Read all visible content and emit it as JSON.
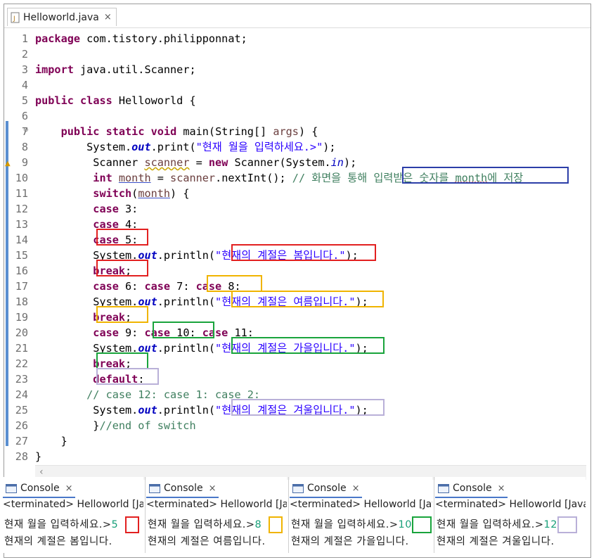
{
  "editor_tab": {
    "title": "Helloworld.java",
    "close": "×"
  },
  "code_lines": [
    {
      "n": "1",
      "segments": [
        {
          "t": "package",
          "c": "kw"
        },
        {
          "t": " com.tistory.philipponnat;",
          "c": ""
        }
      ]
    },
    {
      "n": "2",
      "segments": []
    },
    {
      "n": "3",
      "segments": [
        {
          "t": "import",
          "c": "kw"
        },
        {
          "t": " java.util.Scanner;",
          "c": ""
        }
      ]
    },
    {
      "n": "4",
      "segments": []
    },
    {
      "n": "5",
      "segments": [
        {
          "t": "public",
          "c": "kw"
        },
        {
          "t": " ",
          "c": ""
        },
        {
          "t": "class",
          "c": "kw"
        },
        {
          "t": " Helloworld {",
          "c": ""
        }
      ]
    },
    {
      "n": "6",
      "segments": []
    },
    {
      "n": "7",
      "segments": [
        {
          "t": "    ",
          "c": ""
        },
        {
          "t": "public",
          "c": "kw"
        },
        {
          "t": " ",
          "c": ""
        },
        {
          "t": "static",
          "c": "kw"
        },
        {
          "t": " ",
          "c": ""
        },
        {
          "t": "void",
          "c": "kw"
        },
        {
          "t": " main(String[] ",
          "c": ""
        },
        {
          "t": "args",
          "c": "var"
        },
        {
          "t": ") {",
          "c": ""
        }
      ]
    },
    {
      "n": "8",
      "segments": [
        {
          "t": "        System.",
          "c": ""
        },
        {
          "t": "out",
          "c": "fld"
        },
        {
          "t": ".print(",
          "c": ""
        },
        {
          "t": "\"현재 월을 입력하세요.>\"",
          "c": "str"
        },
        {
          "t": ");",
          "c": ""
        }
      ]
    },
    {
      "n": "9",
      "segments": [
        {
          "t": "         Scanner ",
          "c": ""
        },
        {
          "t": "scanner",
          "c": "uvar"
        },
        {
          "t": " = ",
          "c": ""
        },
        {
          "t": "new",
          "c": "kw"
        },
        {
          "t": " Scanner(System.",
          "c": ""
        },
        {
          "t": "in",
          "c": "fldi"
        },
        {
          "t": ");",
          "c": ""
        }
      ]
    },
    {
      "n": "10",
      "segments": [
        {
          "t": "         ",
          "c": ""
        },
        {
          "t": "int",
          "c": "kw"
        },
        {
          "t": " ",
          "c": ""
        },
        {
          "t": "month",
          "c": "ovr"
        },
        {
          "t": " = ",
          "c": ""
        },
        {
          "t": "scanner",
          "c": "var"
        },
        {
          "t": ".nextInt(); ",
          "c": ""
        },
        {
          "t": "// 화면을 통해 입력받은 숫자를 ",
          "c": "cm"
        },
        {
          "t": "month",
          "c": "cm spell"
        },
        {
          "t": "에 저장",
          "c": "cm"
        }
      ]
    },
    {
      "n": "11",
      "segments": [
        {
          "t": "         ",
          "c": ""
        },
        {
          "t": "switch",
          "c": "kw"
        },
        {
          "t": "(",
          "c": ""
        },
        {
          "t": "month",
          "c": "ovr"
        },
        {
          "t": ") {",
          "c": ""
        }
      ]
    },
    {
      "n": "12",
      "segments": [
        {
          "t": "         ",
          "c": ""
        },
        {
          "t": "case",
          "c": "kw"
        },
        {
          "t": " 3:",
          "c": ""
        }
      ]
    },
    {
      "n": "13",
      "segments": [
        {
          "t": "         ",
          "c": ""
        },
        {
          "t": "case",
          "c": "kw"
        },
        {
          "t": " 4:",
          "c": ""
        }
      ]
    },
    {
      "n": "14",
      "segments": [
        {
          "t": "         ",
          "c": ""
        },
        {
          "t": "case",
          "c": "kw"
        },
        {
          "t": " 5:",
          "c": ""
        }
      ]
    },
    {
      "n": "15",
      "segments": [
        {
          "t": "         System.",
          "c": ""
        },
        {
          "t": "out",
          "c": "fld"
        },
        {
          "t": ".println(",
          "c": ""
        },
        {
          "t": "\"현재의 계절은 봄입니다.\"",
          "c": "str"
        },
        {
          "t": ");",
          "c": ""
        }
      ]
    },
    {
      "n": "16",
      "segments": [
        {
          "t": "         ",
          "c": ""
        },
        {
          "t": "break",
          "c": "kw"
        },
        {
          "t": ";",
          "c": ""
        }
      ]
    },
    {
      "n": "17",
      "segments": [
        {
          "t": "         ",
          "c": ""
        },
        {
          "t": "case",
          "c": "kw"
        },
        {
          "t": " 6: ",
          "c": ""
        },
        {
          "t": "case",
          "c": "kw"
        },
        {
          "t": " 7: ",
          "c": ""
        },
        {
          "t": "case",
          "c": "kw"
        },
        {
          "t": " 8:",
          "c": ""
        }
      ]
    },
    {
      "n": "18",
      "segments": [
        {
          "t": "         System.",
          "c": ""
        },
        {
          "t": "out",
          "c": "fld"
        },
        {
          "t": ".println(",
          "c": ""
        },
        {
          "t": "\"현재의 계절은 여름입니다.\"",
          "c": "str"
        },
        {
          "t": ");",
          "c": ""
        }
      ]
    },
    {
      "n": "19",
      "segments": [
        {
          "t": "         ",
          "c": ""
        },
        {
          "t": "break",
          "c": "kw"
        },
        {
          "t": ";",
          "c": ""
        }
      ]
    },
    {
      "n": "20",
      "segments": [
        {
          "t": "         ",
          "c": ""
        },
        {
          "t": "case",
          "c": "kw"
        },
        {
          "t": " 9: ",
          "c": ""
        },
        {
          "t": "case",
          "c": "kw"
        },
        {
          "t": " 10: ",
          "c": ""
        },
        {
          "t": "case",
          "c": "kw"
        },
        {
          "t": " 11:",
          "c": ""
        }
      ]
    },
    {
      "n": "21",
      "segments": [
        {
          "t": "         System.",
          "c": ""
        },
        {
          "t": "out",
          "c": "fld"
        },
        {
          "t": ".println(",
          "c": ""
        },
        {
          "t": "\"현재의 계절은 가을입니다.\"",
          "c": "str"
        },
        {
          "t": ");",
          "c": ""
        }
      ]
    },
    {
      "n": "22",
      "segments": [
        {
          "t": "         ",
          "c": ""
        },
        {
          "t": "break",
          "c": "kw"
        },
        {
          "t": ";",
          "c": ""
        }
      ]
    },
    {
      "n": "23",
      "segments": [
        {
          "t": "         ",
          "c": ""
        },
        {
          "t": "default",
          "c": "kw"
        },
        {
          "t": ":",
          "c": ""
        }
      ]
    },
    {
      "n": "24",
      "segments": [
        {
          "t": "        ",
          "c": ""
        },
        {
          "t": "// case 12: case 1: case 2:",
          "c": "cm"
        }
      ]
    },
    {
      "n": "25",
      "segments": [
        {
          "t": "         System.",
          "c": ""
        },
        {
          "t": "out",
          "c": "fld"
        },
        {
          "t": ".println(",
          "c": ""
        },
        {
          "t": "\"현재의 계절은 겨울입니다.\"",
          "c": "str"
        },
        {
          "t": ");",
          "c": ""
        }
      ]
    },
    {
      "n": "26",
      "segments": [
        {
          "t": "         }",
          "c": ""
        },
        {
          "t": "//end of switch",
          "c": "cm"
        }
      ]
    },
    {
      "n": "27",
      "segments": [
        {
          "t": "    }",
          "c": ""
        }
      ]
    },
    {
      "n": "28",
      "segments": [
        {
          "t": "}",
          "c": ""
        }
      ]
    }
  ],
  "consoles": [
    {
      "tab": "Console",
      "close": "×",
      "terminated": "<terminated> Helloworld [Ja",
      "prompt": "현재 월을 입력하세요.>",
      "input": "5",
      "result": "현재의 계절은 봄입니다."
    },
    {
      "tab": "Console",
      "close": "×",
      "terminated": "<terminated> Helloworld [Ja",
      "prompt": "현재 월을 입력하세요.>",
      "input": "8",
      "result": "현재의 계절은 여름입니다."
    },
    {
      "tab": "Console",
      "close": "×",
      "terminated": "<terminated> Helloworld [Jav",
      "prompt": "현재 월을 입력하세요.>",
      "input": "10",
      "result": "현재의 계절은 가을입니다."
    },
    {
      "tab": "Console",
      "close": "×",
      "terminated": "<terminated> Helloworld [Java",
      "prompt": "현재 월을 입력하세요.>",
      "input": "12",
      "result": "현재의 계절은 겨울입니다."
    }
  ],
  "colors": {
    "keyword": "#7f0055",
    "string": "#2a00ff",
    "comment": "#3f7f5f",
    "field": "#0000c0",
    "input": "#19a07a"
  }
}
